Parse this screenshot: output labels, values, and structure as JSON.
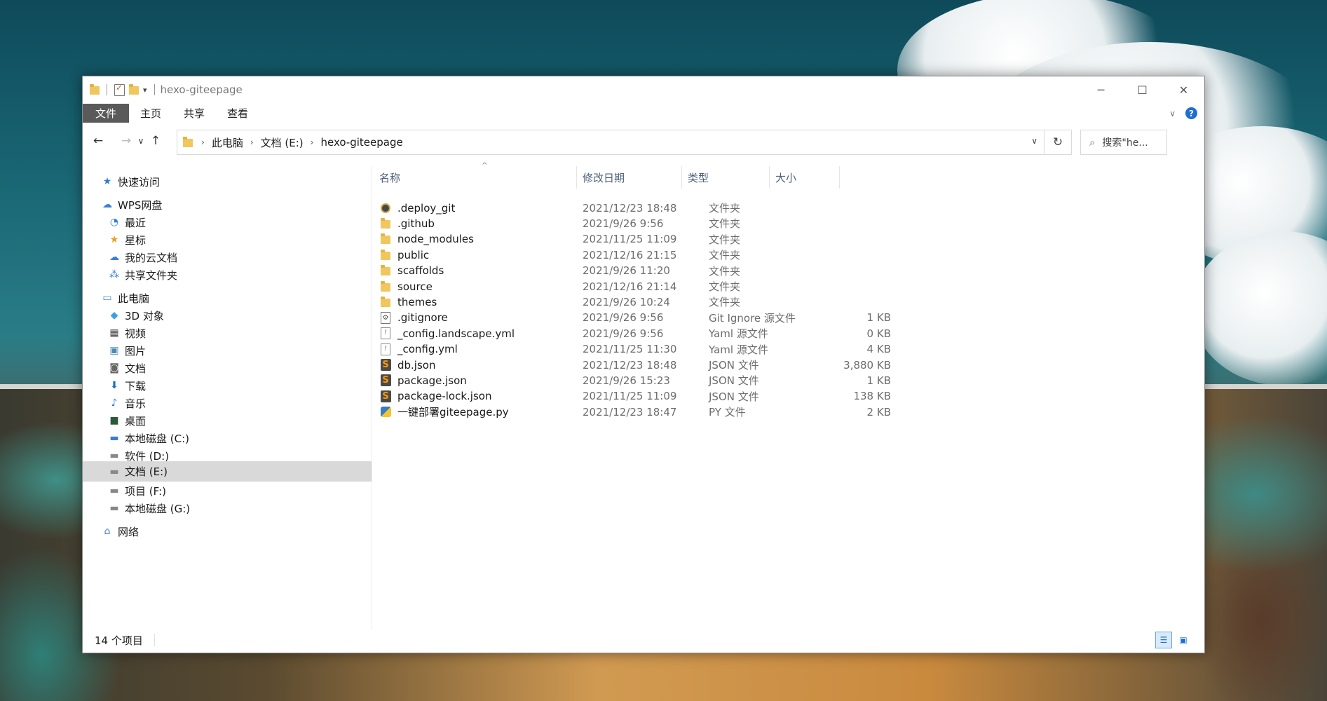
{
  "window": {
    "title": "hexo-giteepage",
    "minimize_glyph": "─",
    "maximize_glyph": "☐",
    "close_glyph": "✕"
  },
  "ribbon": {
    "tabs": [
      "文件",
      "主页",
      "共享",
      "查看"
    ],
    "help_glyph": "?"
  },
  "navbar": {
    "back_glyph": "←",
    "forward_glyph": "→",
    "recent_glyph": "∨",
    "up_glyph": "↑",
    "breadcrumbs": [
      "此电脑",
      "文档 (E:)",
      "hexo-giteepage"
    ],
    "refresh_glyph": "↻",
    "search_placeholder": "搜索\"he..."
  },
  "sidebar": {
    "items": [
      {
        "label": "快速访问",
        "icon": "star-icon"
      },
      {
        "label": "WPS网盘",
        "icon": "cloud-icon"
      },
      {
        "label": "最近",
        "icon": "clock-icon"
      },
      {
        "label": "星标",
        "icon": "star-icon"
      },
      {
        "label": "我的云文档",
        "icon": "cloud-icon"
      },
      {
        "label": "共享文件夹",
        "icon": "share-icon"
      },
      {
        "label": "此电脑",
        "icon": "computer-icon"
      },
      {
        "label": "3D 对象",
        "icon": "cube-icon"
      },
      {
        "label": "视频",
        "icon": "film-icon"
      },
      {
        "label": "图片",
        "icon": "picture-icon"
      },
      {
        "label": "文档",
        "icon": "document-icon"
      },
      {
        "label": "下载",
        "icon": "download-icon"
      },
      {
        "label": "音乐",
        "icon": "music-icon"
      },
      {
        "label": "桌面",
        "icon": "desktop-icon"
      },
      {
        "label": "本地磁盘 (C:)",
        "icon": "drive-icon"
      },
      {
        "label": "软件 (D:)",
        "icon": "drive-icon"
      },
      {
        "label": "文档 (E:)",
        "icon": "drive-icon"
      },
      {
        "label": "项目 (F:)",
        "icon": "drive-icon"
      },
      {
        "label": "本地磁盘 (G:)",
        "icon": "drive-icon"
      },
      {
        "label": "网络",
        "icon": "network-icon"
      }
    ]
  },
  "columns": {
    "name": "名称",
    "date": "修改日期",
    "type": "类型",
    "size": "大小",
    "sort_glyph": "^"
  },
  "files": [
    {
      "name": ".deploy_git",
      "date": "2021/12/23 18:48",
      "type": "文件夹",
      "size": "",
      "icon": "git-folder-icon"
    },
    {
      "name": ".github",
      "date": "2021/9/26 9:56",
      "type": "文件夹",
      "size": "",
      "icon": "folder-icon"
    },
    {
      "name": "node_modules",
      "date": "2021/11/25 11:09",
      "type": "文件夹",
      "size": "",
      "icon": "folder-icon"
    },
    {
      "name": "public",
      "date": "2021/12/16 21:15",
      "type": "文件夹",
      "size": "",
      "icon": "folder-icon"
    },
    {
      "name": "scaffolds",
      "date": "2021/9/26 11:20",
      "type": "文件夹",
      "size": "",
      "icon": "folder-icon"
    },
    {
      "name": "source",
      "date": "2021/12/16 21:14",
      "type": "文件夹",
      "size": "",
      "icon": "folder-icon"
    },
    {
      "name": "themes",
      "date": "2021/9/26 10:24",
      "type": "文件夹",
      "size": "",
      "icon": "folder-icon"
    },
    {
      "name": ".gitignore",
      "date": "2021/9/26 9:56",
      "type": "Git Ignore 源文件",
      "size": "1 KB",
      "icon": "settings-file-icon"
    },
    {
      "name": "_config.landscape.yml",
      "date": "2021/9/26 9:56",
      "type": "Yaml 源文件",
      "size": "0 KB",
      "icon": "yaml-file-icon"
    },
    {
      "name": "_config.yml",
      "date": "2021/11/25 11:30",
      "type": "Yaml 源文件",
      "size": "4 KB",
      "icon": "yaml-file-icon"
    },
    {
      "name": "db.json",
      "date": "2021/12/23 18:48",
      "type": "JSON 文件",
      "size": "3,880 KB",
      "icon": "sublime-file-icon"
    },
    {
      "name": "package.json",
      "date": "2021/9/26 15:23",
      "type": "JSON 文件",
      "size": "1 KB",
      "icon": "sublime-file-icon"
    },
    {
      "name": "package-lock.json",
      "date": "2021/11/25 11:09",
      "type": "JSON 文件",
      "size": "138 KB",
      "icon": "sublime-file-icon"
    },
    {
      "name": "一键部署giteepage.py",
      "date": "2021/12/23 18:47",
      "type": "PY 文件",
      "size": "2 KB",
      "icon": "python-file-icon"
    }
  ],
  "status": {
    "item_count": "14 个项目"
  },
  "colors": {
    "active_tab_bg": "#5a5a5a",
    "selected_nav_bg": "#d9d9d9",
    "folder_yellow": "#f0c75e",
    "accent_blue": "#1d6fd1"
  }
}
